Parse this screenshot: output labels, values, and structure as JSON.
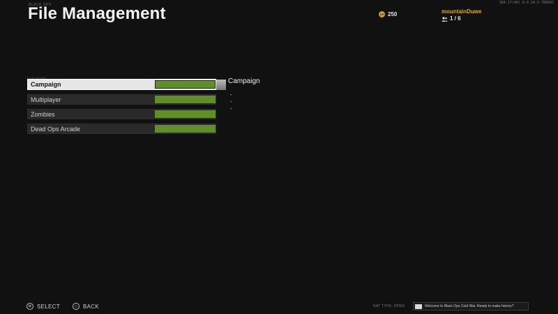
{
  "header": {
    "build_id": "360.17(48) 8.0.24.5.7884SC",
    "breadcrumb": "BLACK OPS",
    "title": "File Management"
  },
  "player": {
    "cp_icon": "cod-points-icon",
    "cp_label": "CP",
    "cp_amount": "250",
    "name": "mountainDuwe",
    "party_icon": "party-members-icon",
    "party_count": "1 / 6"
  },
  "file_list": {
    "header": "FILE SHARE",
    "items": [
      {
        "label": "Campaign",
        "usage": 1.0,
        "selected": true
      },
      {
        "label": "Multiplayer",
        "usage": 1.0,
        "selected": false
      },
      {
        "label": "Zombies",
        "usage": 1.0,
        "selected": false
      },
      {
        "label": "Dead Ops Arcade",
        "usage": 1.0,
        "selected": false
      }
    ],
    "accent_color": "#5f8e2b"
  },
  "detail": {
    "title": "Campaign",
    "lines": [
      "-",
      "-",
      "-"
    ]
  },
  "footer": {
    "select_glyph": "✕",
    "select_label": "SELECT",
    "back_glyph": "○",
    "back_label": "BACK",
    "nat_type": "NAT TYPE: OPEN",
    "motd": "Welcome to Black Ops Cold War. Ready to make history?"
  }
}
